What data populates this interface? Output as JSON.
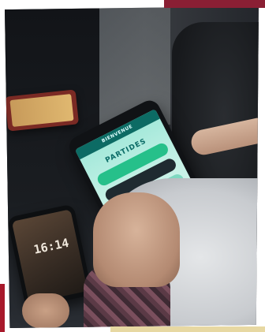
{
  "main_phone": {
    "app_bar_text": "BIENVENUE",
    "screen_title": "PARTIDES"
  },
  "lower_phone": {
    "clock": "16:14"
  },
  "colors": {
    "accent": "#8a1f34",
    "app_green": "#26c08a",
    "app_teal": "#0a6b66"
  }
}
